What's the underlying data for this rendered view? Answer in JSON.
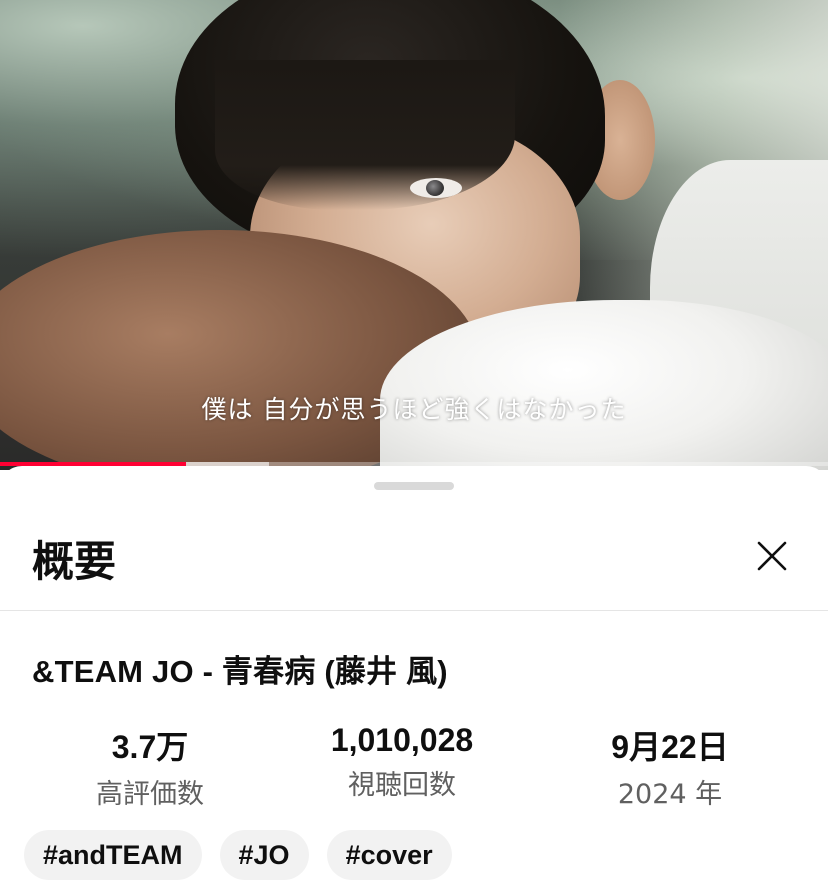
{
  "video": {
    "subtitle": "僕は 自分が思うほど強くはなかった",
    "progress_fraction": 0.225,
    "buffered_fraction": 0.325,
    "progress_color": "#ff0033"
  },
  "description": {
    "header": "概要",
    "close_icon": "close-icon",
    "title": "&TEAM JO - 青春病 (藤井 風)",
    "stats": {
      "likes": {
        "value": "3.7万",
        "label": "高評価数"
      },
      "views": {
        "value": "1,010,028",
        "label": "視聴回数"
      },
      "date": {
        "value": "9月22日",
        "label": "2024 年"
      }
    },
    "tags": [
      "#andTEAM",
      "#JO",
      "#cover"
    ]
  }
}
